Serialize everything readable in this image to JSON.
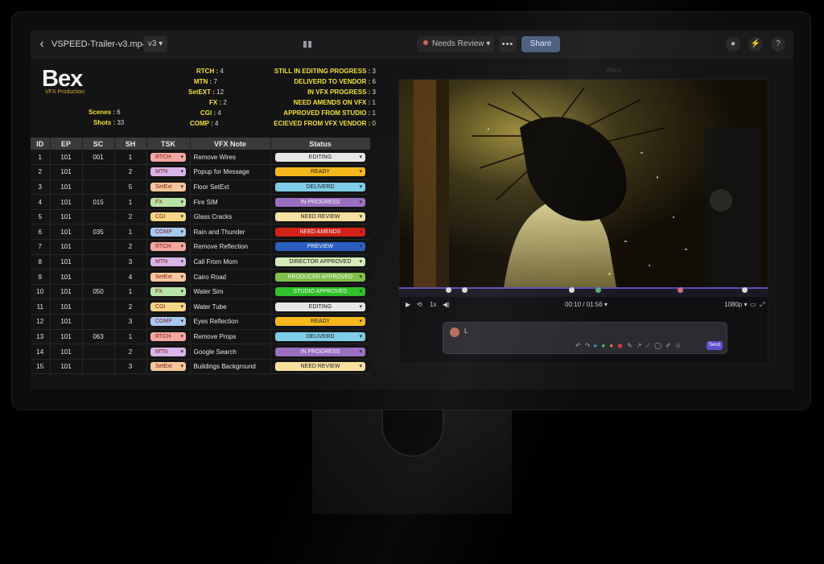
{
  "toolbar": {
    "back_icon": "chevron-left-icon",
    "file_name": "VSPEED-Trailer-v3.mp4",
    "version": "v3 ▾",
    "status": "Needs Review",
    "more": "•••",
    "share": "Share"
  },
  "brand": {
    "logo": "Bex",
    "subtitle": "VFX Production"
  },
  "summary": {
    "scenes_label": "Scenes :",
    "scenes": "6",
    "shots_label": "Shots :",
    "shots": "33",
    "task_counts": [
      {
        "label": "RTCH :",
        "value": "4"
      },
      {
        "label": "MTN :",
        "value": "7"
      },
      {
        "label": "SetEXT :",
        "value": "12"
      },
      {
        "label": "FX :",
        "value": "2"
      },
      {
        "label": "CGI :",
        "value": "4"
      },
      {
        "label": "COMP :",
        "value": "4"
      }
    ],
    "status_counts": [
      {
        "label": "STILL IN EDITING PROGRESS :",
        "value": "3"
      },
      {
        "label": "DELIVERD TO VENDOR :",
        "value": "6"
      },
      {
        "label": "IN VFX PROGRESS :",
        "value": "3"
      },
      {
        "label": "NEED AMENDS ON VFX :",
        "value": "1"
      },
      {
        "label": "APPROVED FROM STUDIO :",
        "value": "1"
      },
      {
        "label": "ECIEVED FROM VFX VENDOR :",
        "value": "0"
      }
    ]
  },
  "table": {
    "headers": [
      "ID",
      "EP",
      "SC",
      "SH",
      "TSK",
      "VFX Note",
      "Status"
    ],
    "rows": [
      {
        "id": "1",
        "ep": "101",
        "sc": "001",
        "sh": "1",
        "tsk": "RTCH",
        "note": "Remove Wires",
        "status": "EDITING"
      },
      {
        "id": "2",
        "ep": "101",
        "sc": "",
        "sh": "2",
        "tsk": "MTN",
        "note": "Popup for Message",
        "status": "READY"
      },
      {
        "id": "3",
        "ep": "101",
        "sc": "",
        "sh": "5",
        "tsk": "SetExt",
        "note": "Floor SetExt",
        "status": "DELIVERD"
      },
      {
        "id": "4",
        "ep": "101",
        "sc": "015",
        "sh": "1",
        "tsk": "FX",
        "note": "Fire SIM",
        "status": "IN PROGRESS"
      },
      {
        "id": "5",
        "ep": "101",
        "sc": "",
        "sh": "2",
        "tsk": "CGI",
        "note": "Glass Cracks",
        "status": "NEED REVIEW"
      },
      {
        "id": "6",
        "ep": "101",
        "sc": "035",
        "sh": "1",
        "tsk": "COMP",
        "note": "Rain and Thunder",
        "status": "NEED AMENDS"
      },
      {
        "id": "7",
        "ep": "101",
        "sc": "",
        "sh": "2",
        "tsk": "RTCH",
        "note": "Remove Reflection",
        "status": "PREVIEW"
      },
      {
        "id": "8",
        "ep": "101",
        "sc": "",
        "sh": "3",
        "tsk": "MTN",
        "note": "Call From Mom",
        "status": "DIRECTOR APPROVED"
      },
      {
        "id": "9",
        "ep": "101",
        "sc": "",
        "sh": "4",
        "tsk": "SetExt",
        "note": "Cairo Road",
        "status": "PRODUCER APPROVED"
      },
      {
        "id": "10",
        "ep": "101",
        "sc": "050",
        "sh": "1",
        "tsk": "FX",
        "note": "Water Sim",
        "status": "STUDIO APPROVED"
      },
      {
        "id": "11",
        "ep": "101",
        "sc": "",
        "sh": "2",
        "tsk": "CGI",
        "note": "Water Tube",
        "status": "EDITING"
      },
      {
        "id": "12",
        "ep": "101",
        "sc": "",
        "sh": "3",
        "tsk": "COMP",
        "note": "Eyes Reflection",
        "status": "READY"
      },
      {
        "id": "13",
        "ep": "101",
        "sc": "063",
        "sh": "1",
        "tsk": "RTCH",
        "note": "Remove Props",
        "status": "DELIVERD"
      },
      {
        "id": "14",
        "ep": "101",
        "sc": "",
        "sh": "2",
        "tsk": "MTN",
        "note": "Google Search",
        "status": "IN PROGRESS"
      },
      {
        "id": "15",
        "ep": "101",
        "sc": "",
        "sh": "3",
        "tsk": "SetExt",
        "note": "Buildings Background",
        "status": "NEED REVIEW"
      }
    ]
  },
  "task_colors": {
    "RTCH": "#f4a7a0",
    "MTN": "#d8b5e8",
    "SetExt": "#f7c79b",
    "FX": "#b9e3a6",
    "CGI": "#f5d586",
    "COMP": "#a9c8f0"
  },
  "status_colors": {
    "EDITING": "#e6e6e6",
    "READY": "#f5b81c",
    "DELIVERD": "#7fcde8",
    "IN PROGRESS": "#9b6fc0",
    "NEED REVIEW": "#f7e0a0",
    "NEED AMENDS": "#d4211a",
    "PREVIEW": "#2a5fc0",
    "DIRECTOR APPROVED": "#d5eab8",
    "PRODUCER APPROVED": "#7fbf4a",
    "STUDIO APPROVED": "#2fc02b"
  },
  "viewer": {
    "label": "Alex"
  },
  "player": {
    "speed": "1x",
    "timecode": "00:10 / 01:56 ▾",
    "quality": "1080p ▾",
    "playhead_fraction": 0.54
  },
  "comment": {
    "text": "L",
    "send": "Send"
  }
}
